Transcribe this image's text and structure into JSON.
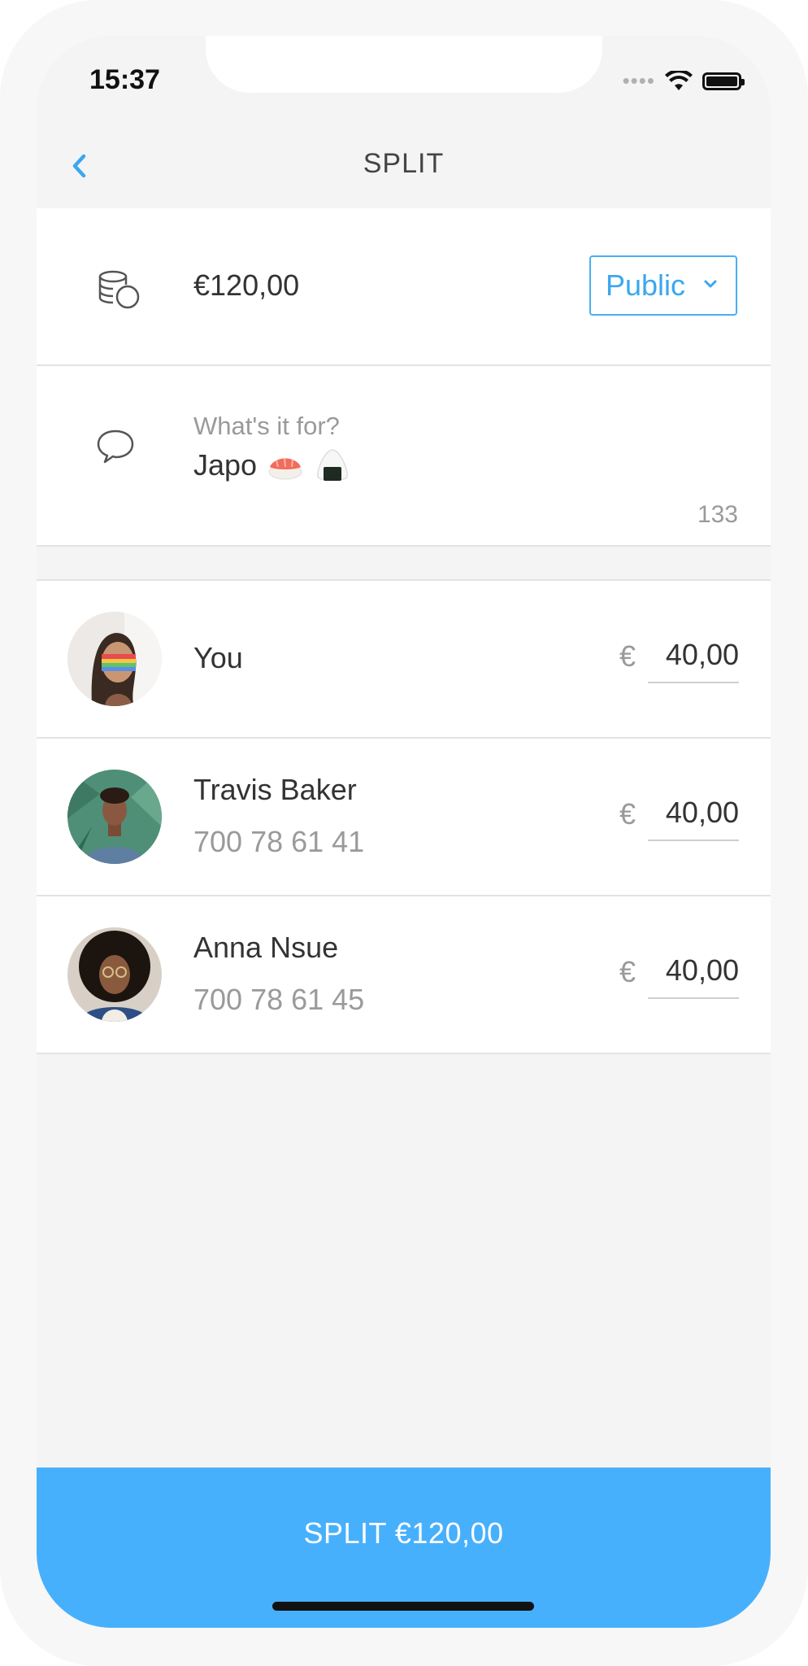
{
  "status_bar": {
    "time": "15:37"
  },
  "navbar": {
    "title": "SPLIT"
  },
  "amount": {
    "value": "€120,00",
    "visibility": "Public"
  },
  "description": {
    "placeholder": "What's it for?",
    "value": "Japo",
    "char_count": "133"
  },
  "participants": [
    {
      "name": "You",
      "phone": "",
      "currency": "€",
      "share": "40,00"
    },
    {
      "name": "Travis Baker",
      "phone": "700 78 61 41",
      "currency": "€",
      "share": "40,00"
    },
    {
      "name": "Anna Nsue",
      "phone": "700 78 61 45",
      "currency": "€",
      "share": "40,00"
    }
  ],
  "split_button": {
    "label": "SPLIT €120,00"
  },
  "colors": {
    "accent": "#47b0fc",
    "text": "#333333",
    "muted": "#9a9a9a",
    "background": "#f4f4f4"
  }
}
